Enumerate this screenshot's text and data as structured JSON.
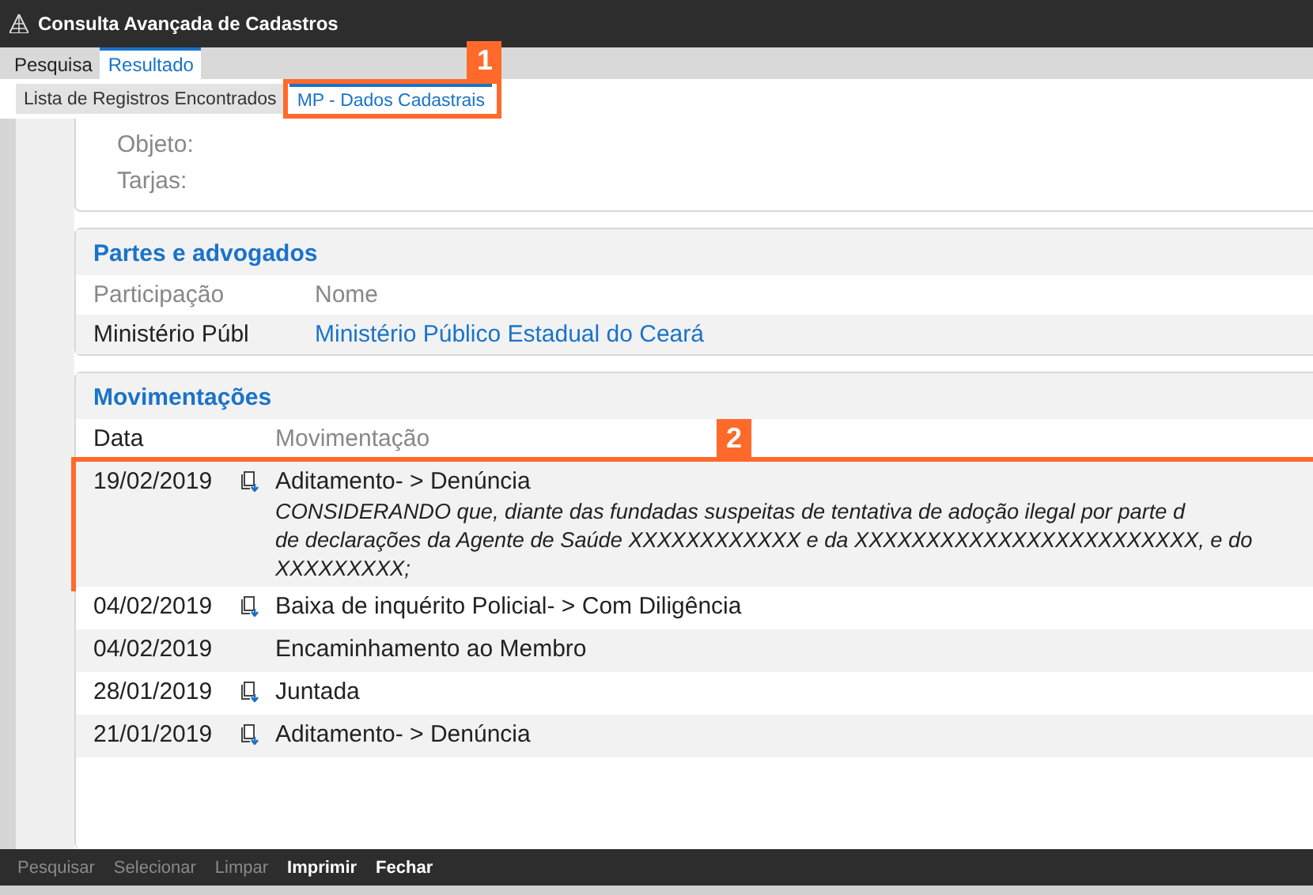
{
  "window": {
    "title": "Consulta Avançada de Cadastros"
  },
  "tabs": [
    {
      "label": "Pesquisa",
      "selected": false
    },
    {
      "label": "Resultado",
      "selected": true
    }
  ],
  "subtabs": [
    {
      "label": "Lista de Registros Encontrados",
      "selected": false
    },
    {
      "label": "MP - Dados Cadastrais",
      "selected": true,
      "callout": "1"
    }
  ],
  "details": {
    "fields": [
      {
        "label": "Objeto:"
      },
      {
        "label": "Tarjas:"
      }
    ]
  },
  "parties": {
    "title": "Partes e advogados",
    "columns": [
      "Participação",
      "Nome"
    ],
    "rows": [
      {
        "participacao": "Ministério Públ",
        "nome": "Ministério Público Estadual do Ceará"
      }
    ]
  },
  "movements": {
    "title": "Movimentações",
    "columns": [
      "Data",
      "Movimentação"
    ],
    "rows": [
      {
        "date": "19/02/2019",
        "document": true,
        "title": "Aditamento- > Denúncia",
        "callout": "2",
        "description": [
          "CONSIDERANDO que, diante das fundadas suspeitas de tentativa de adoção ilegal por parte d",
          "de declarações da Agente de Saúde XXXXXXXXXXXX e da XXXXXXXXXXXXXXXXXXXXXXXX, e do",
          "XXXXXXXXX;"
        ]
      },
      {
        "date": "04/02/2019",
        "document": true,
        "title": "Baixa de inquérito Policial- > Com Diligência",
        "callout": null,
        "description": []
      },
      {
        "date": "04/02/2019",
        "document": false,
        "title": "Encaminhamento ao Membro",
        "callout": null,
        "description": []
      },
      {
        "date": "28/01/2019",
        "document": true,
        "title": "Juntada",
        "callout": null,
        "description": []
      },
      {
        "date": "21/01/2019",
        "document": true,
        "title": "Aditamento- > Denúncia",
        "callout": null,
        "description": []
      }
    ]
  },
  "toolbar": [
    {
      "label": "Pesquisar",
      "disabled": true
    },
    {
      "label": "Selecionar",
      "disabled": true
    },
    {
      "label": "Limpar",
      "disabled": true
    },
    {
      "label": "Imprimir",
      "disabled": false
    },
    {
      "label": "Fechar",
      "disabled": false
    }
  ]
}
